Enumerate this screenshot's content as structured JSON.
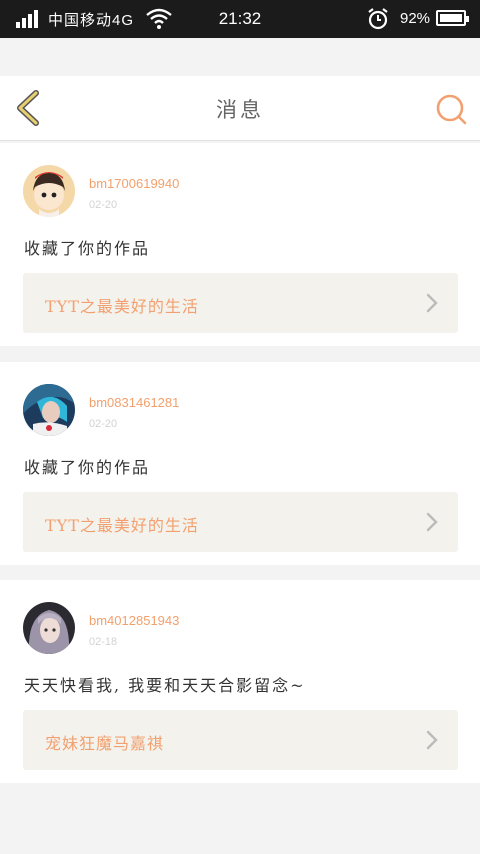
{
  "status_bar": {
    "carrier": "中国移动4G",
    "time": "21:32",
    "battery": "92%",
    "battery_level": 0.92
  },
  "header": {
    "title": "消息",
    "icons": {
      "back": "chevron-left-icon",
      "search": "search-icon"
    },
    "colors": {
      "back": "#e8d070",
      "search": "#f3a070"
    }
  },
  "messages": [
    {
      "username": "bm1700619940",
      "date": "02-20",
      "text": "收藏了你的作品",
      "work_title": "TYT之最美好的生活"
    },
    {
      "username": "bm0831461281",
      "date": "02-20",
      "text": "收藏了你的作品",
      "work_title": "TYT之最美好的生活"
    },
    {
      "username": "bm4012851943",
      "date": "02-18",
      "text": "天天快看我, 我要和天天合影留念~",
      "work_title": "宠妹狂魔马嘉祺"
    }
  ],
  "colors": {
    "accent": "#f3a070",
    "username": "#f2a06c",
    "card_link_bg": "#f3f2ec",
    "page_bg": "#f3f3f3"
  }
}
